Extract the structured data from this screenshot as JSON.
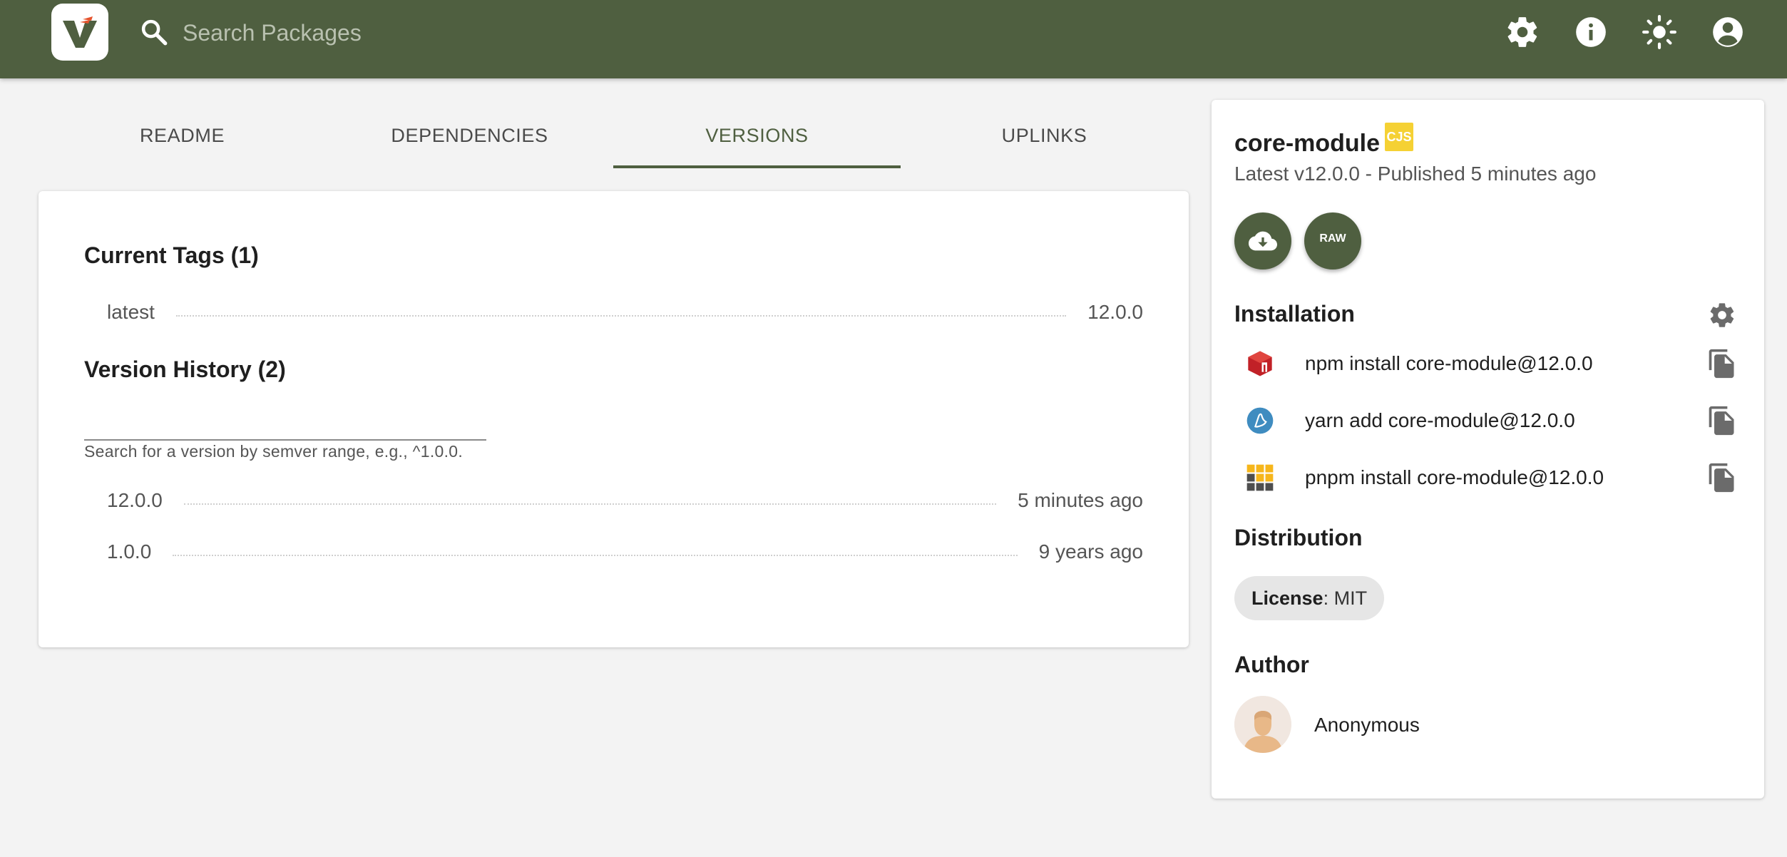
{
  "header": {
    "search_placeholder": "Search Packages",
    "icons": [
      "settings-icon",
      "info-icon",
      "theme-toggle-icon",
      "account-icon"
    ],
    "bar_color": "#4f5f40"
  },
  "tabs": [
    {
      "label": "README",
      "active": false
    },
    {
      "label": "DEPENDENCIES",
      "active": false
    },
    {
      "label": "VERSIONS",
      "active": true
    },
    {
      "label": "UPLINKS",
      "active": false
    }
  ],
  "versions": {
    "current_tags_title": "Current Tags (1)",
    "tags": [
      {
        "name": "latest",
        "version": "12.0.0"
      }
    ],
    "history_title": "Version History (2)",
    "search_value": "",
    "search_helper": "Search for a version by semver range, e.g., ^1.0.0.",
    "history": [
      {
        "version": "12.0.0",
        "time": "5 minutes ago"
      },
      {
        "version": "1.0.0",
        "time": "9 years ago"
      }
    ]
  },
  "sidebar": {
    "package_name": "core-module",
    "module_badge": "CJS",
    "subtitle": "Latest v12.0.0 - Published 5 minutes ago",
    "raw_label": "RAW",
    "installation_title": "Installation",
    "install_commands": [
      {
        "manager": "npm",
        "icon": "npm-icon",
        "command": "npm install core-module@12.0.0"
      },
      {
        "manager": "yarn",
        "icon": "yarn-icon",
        "command": "yarn add core-module@12.0.0"
      },
      {
        "manager": "pnpm",
        "icon": "pnpm-icon",
        "command": "pnpm install core-module@12.0.0"
      }
    ],
    "distribution_title": "Distribution",
    "license_label": "License",
    "license_value": "MIT",
    "author_title": "Author",
    "author_name": "Anonymous"
  }
}
